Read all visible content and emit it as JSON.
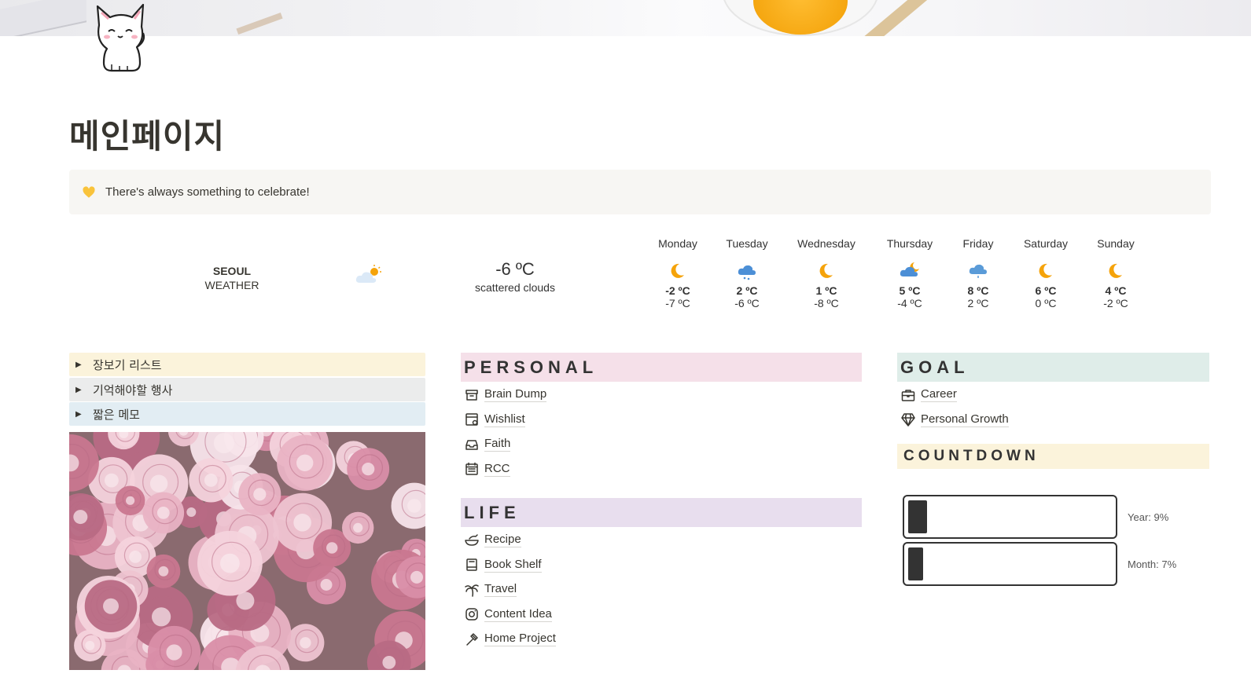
{
  "page": {
    "title": "메인페이지",
    "callout_text": "There's always something to celebrate!"
  },
  "weather": {
    "city": "SEOUL",
    "label": "WEATHER",
    "current_temp": "-6 ºC",
    "description": "scattered clouds",
    "forecast": [
      {
        "day": "Monday",
        "hi": "-2 ºC",
        "lo": "-7 ºC",
        "icon": "moon-icon"
      },
      {
        "day": "Tuesday",
        "hi": "2 ºC",
        "lo": "-6 ºC",
        "icon": "snow-cloud-icon"
      },
      {
        "day": "Wednesday",
        "hi": "1 ºC",
        "lo": "-8 ºC",
        "icon": "moon-icon"
      },
      {
        "day": "Thursday",
        "hi": "5 ºC",
        "lo": "-4 ºC",
        "icon": "cloud-moon-icon"
      },
      {
        "day": "Friday",
        "hi": "8 ºC",
        "lo": "2 ºC",
        "icon": "rain-cloud-icon"
      },
      {
        "day": "Saturday",
        "hi": "6 ºC",
        "lo": "0 ºC",
        "icon": "moon-icon"
      },
      {
        "day": "Sunday",
        "hi": "4 ºC",
        "lo": "-2 ºC",
        "icon": "moon-icon"
      }
    ]
  },
  "toggles": [
    "장보기 리스트",
    "기억해야할 행사",
    "짧은 메모"
  ],
  "personal": {
    "header": "PERSONAL",
    "items": [
      {
        "label": "Brain Dump",
        "icon": "archive-icon"
      },
      {
        "label": "Wishlist",
        "icon": "card-icon"
      },
      {
        "label": "Faith",
        "icon": "inbox-icon"
      },
      {
        "label": "RCC",
        "icon": "calendar-icon"
      }
    ]
  },
  "life": {
    "header": "LIFE",
    "items": [
      {
        "label": "Recipe",
        "icon": "bowl-icon"
      },
      {
        "label": "Book Shelf",
        "icon": "book-icon"
      },
      {
        "label": "Travel",
        "icon": "palm-tree-icon"
      },
      {
        "label": "Content Idea",
        "icon": "instagram-icon"
      },
      {
        "label": "Home Project",
        "icon": "hammer-icon"
      }
    ]
  },
  "goal": {
    "header": "GOAL",
    "items": [
      {
        "label": "Career",
        "icon": "briefcase-icon"
      },
      {
        "label": "Personal Growth",
        "icon": "diamond-icon"
      }
    ]
  },
  "countdown": {
    "header": "COUNTDOWN",
    "year_label": "Year: 9%",
    "year_progress": 0.09,
    "month_label": "Month: 7%",
    "month_progress": 0.07
  },
  "colors": {
    "weather_moon": "#f5a30a",
    "weather_cloud": "#5a9bd8",
    "progress_fill": "#333333"
  }
}
